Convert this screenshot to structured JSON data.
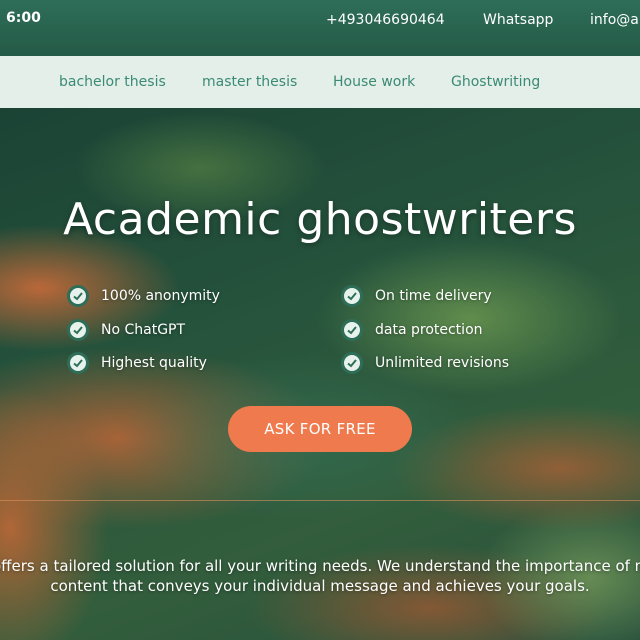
{
  "topbar": {
    "hours": "6:00",
    "phone": "+493046690464",
    "whatsapp": "Whatsapp",
    "email": "info@al"
  },
  "nav": {
    "items": [
      "bachelor thesis",
      "master thesis",
      "House work",
      "Ghostwriting"
    ]
  },
  "hero": {
    "title": "Academic ghostwriters",
    "features_left": [
      "100% anonymity",
      "No ChatGPT",
      "Highest quality"
    ],
    "features_right": [
      "On time delivery",
      "data protection",
      "Unlimited revisions"
    ],
    "cta_label": "ASK FOR FREE",
    "intro_line1": "offers a tailored solution for all your writing needs. We understand the importance of m",
    "intro_line2": "content that conveys your individual message and achieves your goals."
  },
  "colors": {
    "topbar_bg": "#2a6450",
    "nav_bg": "#e4efea",
    "nav_text": "#3a8a74",
    "accent_cta": "#ef7a4d",
    "check_icon": "#2e6e58"
  },
  "icons": {
    "feature": "check-circle-icon"
  }
}
